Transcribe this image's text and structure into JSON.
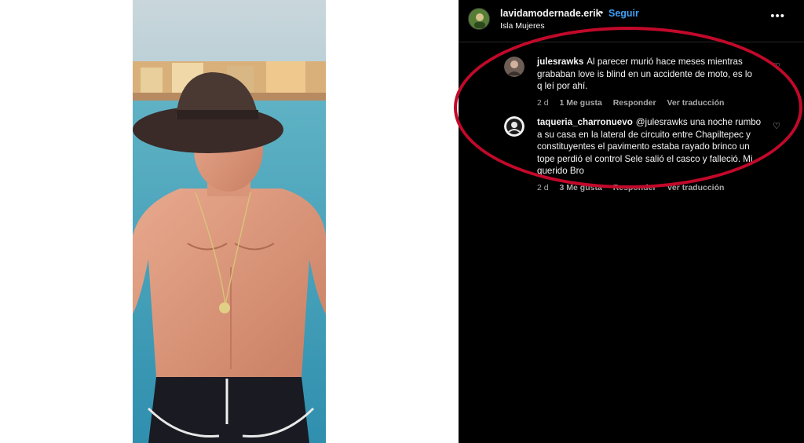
{
  "post": {
    "username": "lavidamodernade.erik",
    "separator": "•",
    "follow_label": "Seguir",
    "location": "Isla Mujeres",
    "more_icon": "more-horizontal-icon"
  },
  "comments": [
    {
      "username": "julesrawks",
      "text": "Al parecer murió hace meses mientras grababan love is blind en un accidente de moto, es lo q leí por ahí.",
      "time": "2 d",
      "likes": "1 Me gusta",
      "reply_label": "Responder",
      "translate_label": "Ver traducción",
      "like_icon": "heart-icon"
    },
    {
      "username": "taqueria_charronuevo",
      "text": "@julesrawks una noche rumbo a su casa en la lateral de circuito entre Chapiltepec y constituyentes el pavimento estaba rayado brinco un tope perdió el control Sele salió el casco y falleció. Mi querido Bro",
      "time": "2 d",
      "likes": "3 Me gusta",
      "reply_label": "Responder",
      "translate_label": "Ver traducción",
      "like_icon": "heart-icon"
    }
  ],
  "colors": {
    "panel_background": "#000000",
    "follow": "#3fa0f6",
    "annotation_circle": "#c2092a"
  }
}
